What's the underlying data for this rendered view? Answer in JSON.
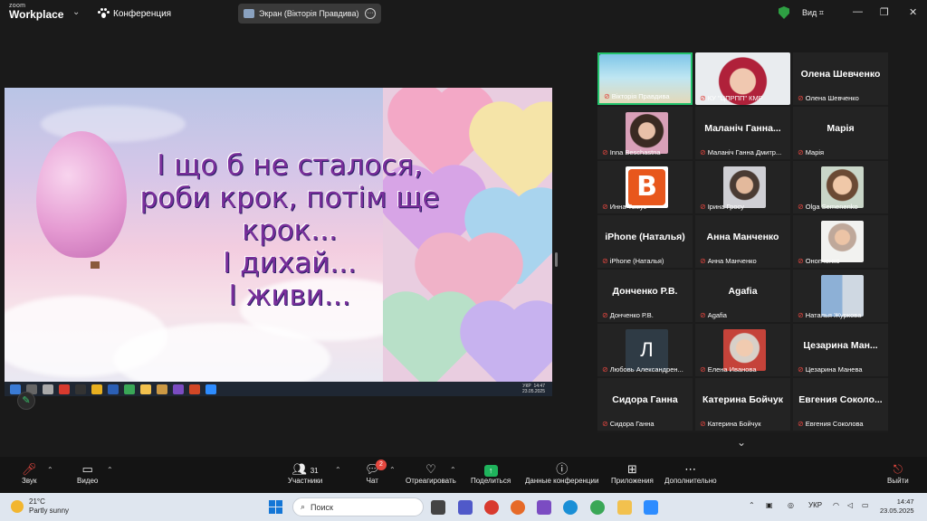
{
  "titlebar": {
    "logo_top": "zoom",
    "logo_bottom": "Workplace",
    "meeting_label": "Конференция",
    "screen_tab": "Экран (Вікторія Правдива)",
    "view_label": "Вид"
  },
  "slide": {
    "lines": [
      "І що б не сталося,",
      "роби крок, потім ще",
      "крок...",
      "І дихай...",
      "І живи..."
    ]
  },
  "presenter_taskbar": {
    "lang": "УКР",
    "time": "14:47",
    "date": "23.05.2025"
  },
  "participants": [
    {
      "label": "Вікторія Правдива",
      "name": "",
      "video": "beach"
    },
    {
      "label": "КУ \"ЦПРПП\" КМР",
      "name": "",
      "video": "woman-red"
    },
    {
      "label": "Олена Шевченко",
      "name": "Олена Шевченко",
      "video": ""
    },
    {
      "label": "Inna Beschastna",
      "name": "",
      "video": "woman-dark"
    },
    {
      "label": "Маланіч Ганна Дмитр...",
      "name": "Маланіч Ганна...",
      "video": ""
    },
    {
      "label": "Марія",
      "name": "Марія",
      "video": ""
    },
    {
      "label": "Инна Томуз",
      "name": "",
      "video": "logo-b"
    },
    {
      "label": "Ірина Гросу",
      "name": "",
      "video": "woman-hijab"
    },
    {
      "label": "Olga Semenenko",
      "name": "",
      "video": "woman-light"
    },
    {
      "label": "iPhone (Наталья)",
      "name": "iPhone (Наталья)",
      "video": ""
    },
    {
      "label": "Анна Манченко",
      "name": "Анна Манченко",
      "video": ""
    },
    {
      "label": "Онопченко",
      "name": "",
      "video": "woman-room"
    },
    {
      "label": "Донченко Р.В.",
      "name": "Донченко Р.В.",
      "video": ""
    },
    {
      "label": "Agafia",
      "name": "Agafia",
      "video": ""
    },
    {
      "label": "Наталья Журкова",
      "name": "",
      "video": "couple"
    },
    {
      "label": "Любовь Александрен...",
      "name": "",
      "video": "initial-l"
    },
    {
      "label": "Елена Иванова",
      "name": "",
      "video": "woman-old"
    },
    {
      "label": "Цезарина Манева",
      "name": "Цезарина Ман...",
      "video": ""
    },
    {
      "label": "Сидора Ганна",
      "name": "Сидора Ганна",
      "video": ""
    },
    {
      "label": "Катерина Бойчук",
      "name": "Катерина Бойчук",
      "video": ""
    },
    {
      "label": "Евгения Соколова",
      "name": "Евгения Соколо...",
      "video": ""
    }
  ],
  "initial_letter": "Л",
  "toolbar": {
    "audio": "Звук",
    "video": "Видео",
    "participants": "Участники",
    "participants_count": "31",
    "chat": "Чат",
    "chat_badge": "2",
    "react": "Отреагировать",
    "share": "Поделиться",
    "meeting_info": "Данные конференции",
    "apps": "Приложения",
    "more": "Дополнительно",
    "leave": "Выйти"
  },
  "taskbar": {
    "temp": "21°C",
    "weather": "Partly sunny",
    "search_placeholder": "Поиск",
    "lang": "УКР",
    "time": "14:47",
    "date": "23.05.2025"
  },
  "colors": {
    "accent_green": "#23c26b",
    "mic_red": "#e0463f",
    "slide_text": "#7a2f9b"
  }
}
